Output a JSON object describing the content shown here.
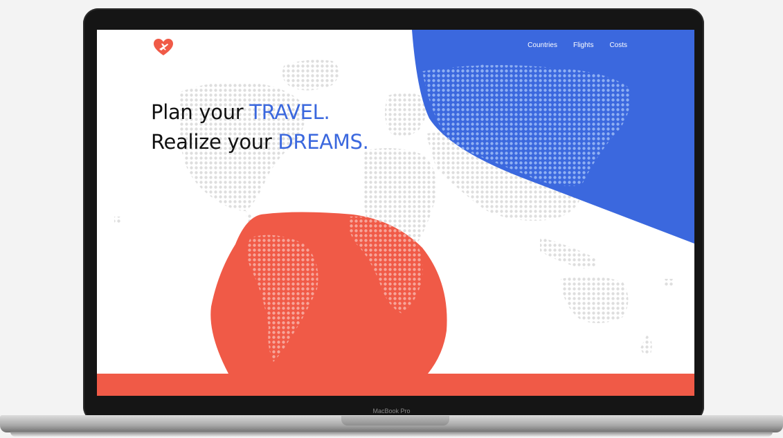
{
  "device": {
    "brand_label": "MacBook Pro"
  },
  "site": {
    "logo_icon": "heart-plane-icon",
    "nav": [
      {
        "label": "Countries"
      },
      {
        "label": "Flights"
      },
      {
        "label": "Costs"
      }
    ],
    "headline": {
      "line1_prefix": "Plan your ",
      "line1_accent": "TRAVEL.",
      "line2_prefix": "Realize your ",
      "line2_accent": "DREAMS."
    }
  },
  "colors": {
    "accent_blue": "#3b68de",
    "accent_red": "#f05a47",
    "text_dark": "#111111",
    "map_dots": "#dcdcdc"
  }
}
